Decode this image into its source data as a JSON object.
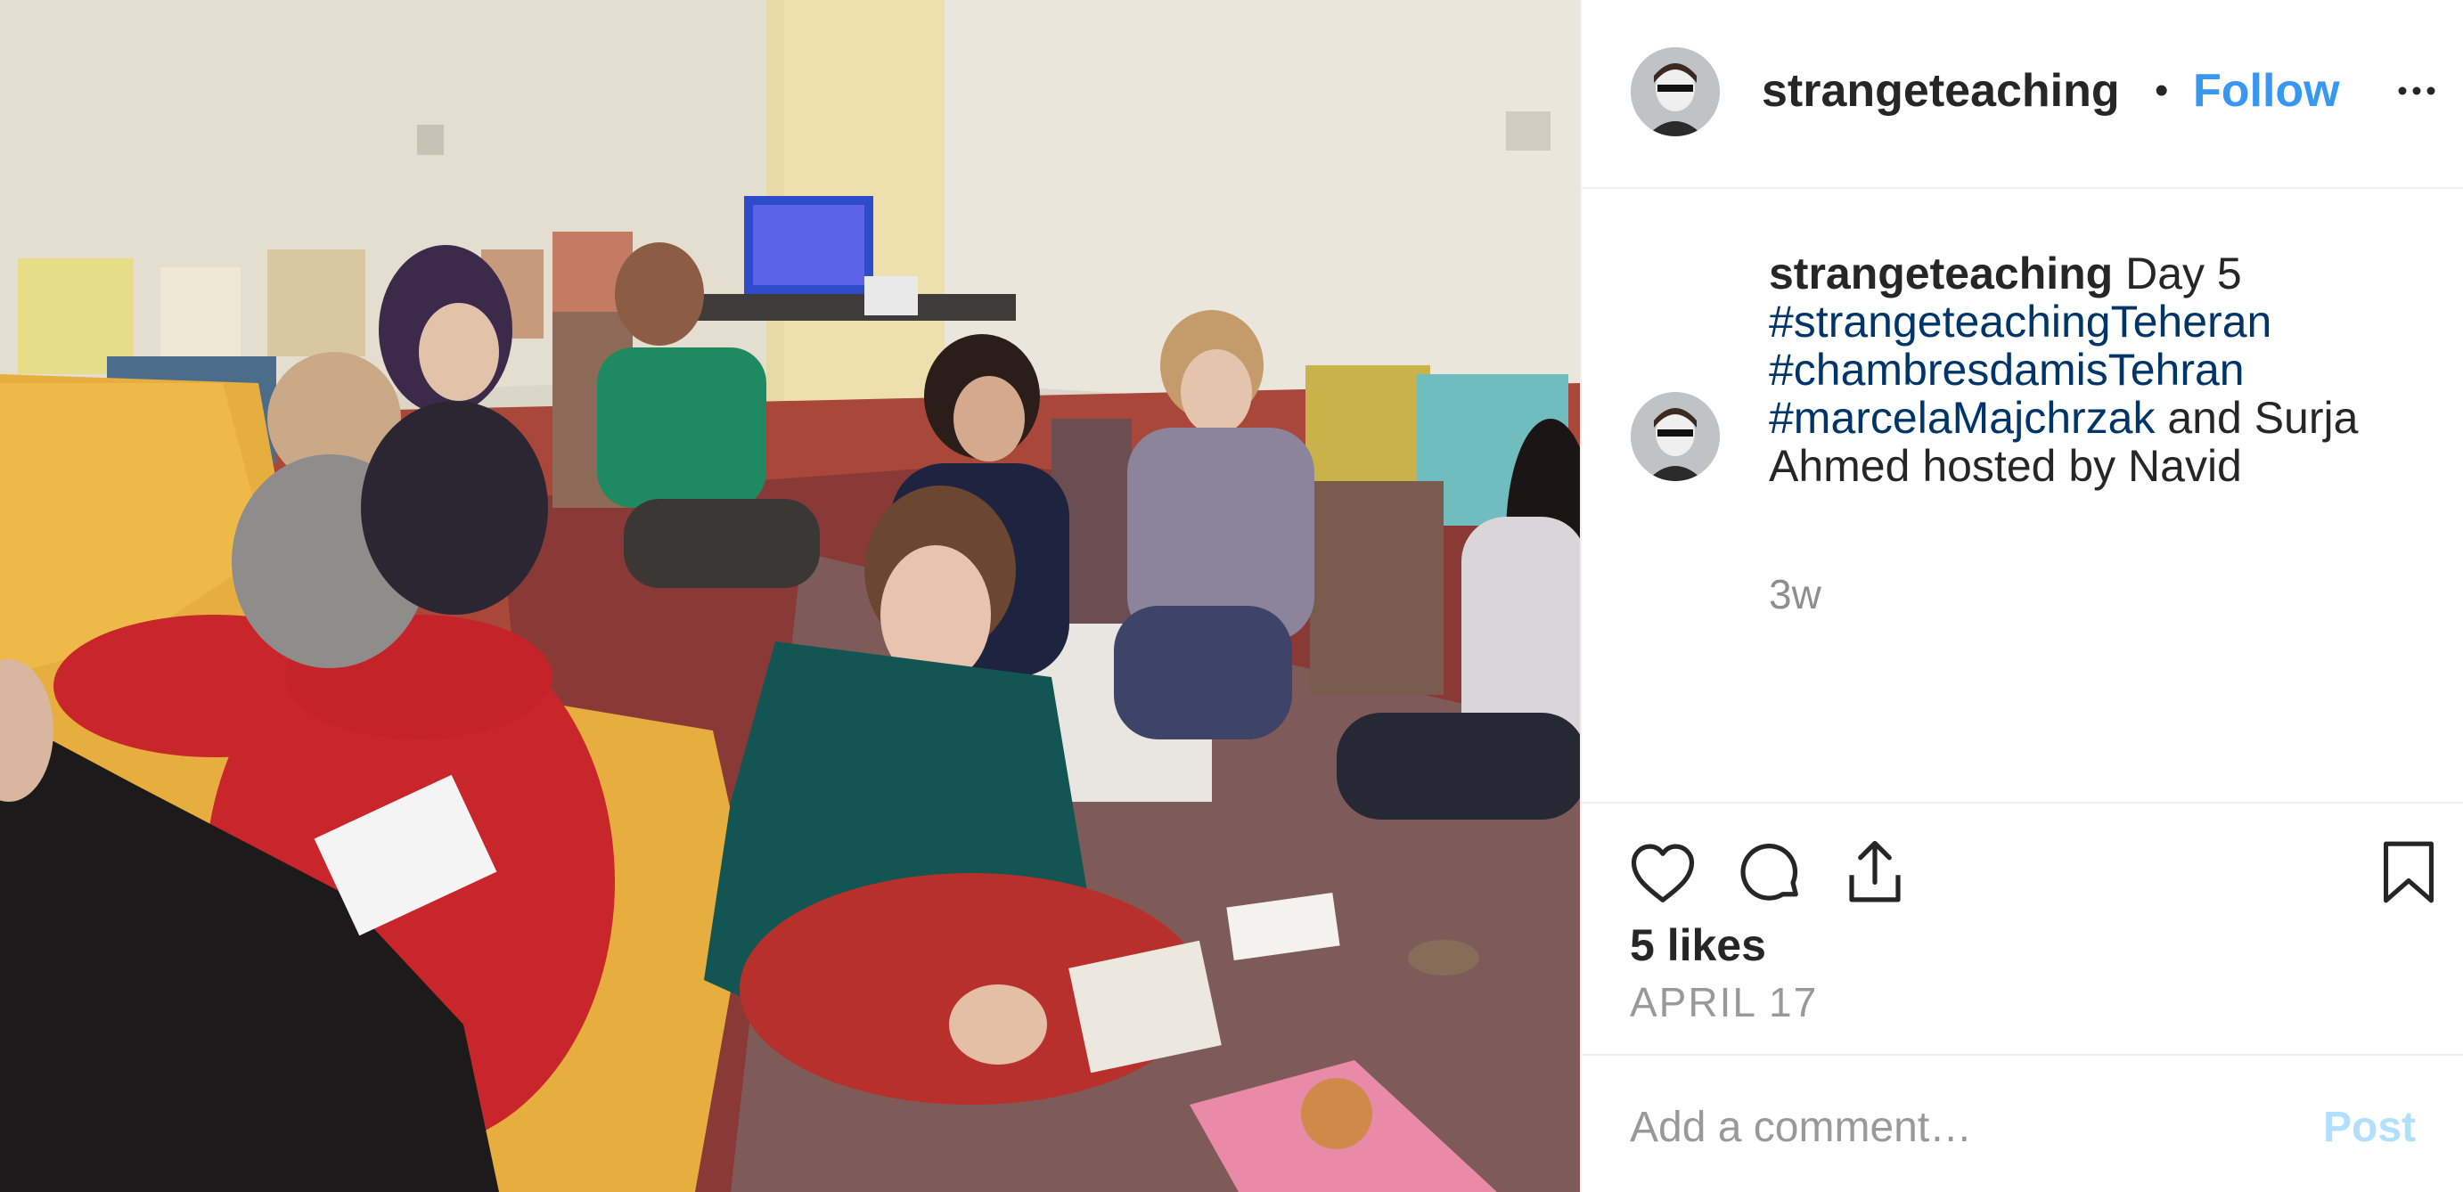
{
  "post": {
    "username": "strangeteaching",
    "follow_label": "Follow",
    "separator": "•",
    "more_icon": "more-horizontal-icon",
    "caption": {
      "username": "strangeteaching",
      "text_1": " Day 5 ",
      "hashtags": [
        "#strangeteachingTeheran",
        "#chambresdamisTehran",
        "#marcelaMajchrzak"
      ],
      "text_2": " and Surja Ahmed hosted by Navid"
    },
    "time_ago": "3w",
    "likes": "5 likes",
    "date": "APRIL 17",
    "comment_placeholder": "Add a comment…",
    "post_label": "Post",
    "icons": [
      "heart-icon",
      "comment-icon",
      "share-icon",
      "bookmark-icon"
    ],
    "colors": {
      "link": "#003569",
      "follow": "#3897f0",
      "post_disabled": "#b2dffc",
      "muted": "#8e8e8e"
    }
  }
}
